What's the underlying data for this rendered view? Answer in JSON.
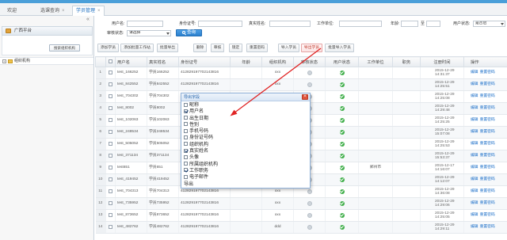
{
  "tabs": [
    {
      "label": "欢迎"
    },
    {
      "label": "选课查询"
    },
    {
      "label": "学员管理"
    }
  ],
  "sidebar": {
    "panel_title": "广西平台",
    "search_button": "搜索组织机构",
    "tree_root": "组织机构"
  },
  "search": {
    "username_label": "用户名:",
    "idcard_label": "身份证号:",
    "realname_label": "真实姓名:",
    "company_label": "工作单位:",
    "age_label": "年龄:",
    "age_to": "至",
    "user_status_label": "用户状态:",
    "user_status_value": "是否启",
    "audit_label": "审核状态:",
    "audit_value": "请选择",
    "query_button": "查询"
  },
  "toolbar": {
    "buttons": [
      "添加学员",
      "添加批量工作站",
      "批量导出",
      "删除",
      "审核",
      "锁定",
      "重置密码",
      "导入学员",
      "导出学员",
      "批量导入学员"
    ]
  },
  "table": {
    "headers": [
      "用户名",
      "真实姓名",
      "身份证号",
      "年龄",
      "组织机构",
      "审核状态",
      "用户状态",
      "工作单位",
      "职务",
      "注册时间",
      "操作"
    ],
    "rows": [
      {
        "num": "1",
        "username": "test_166252",
        "realname": "学员166252",
        "idcard": "412829197702143816",
        "age": "",
        "org": "xxx",
        "audit_icon": "grey-circle-icon",
        "status_icon": "green-check-icon",
        "company": "",
        "position": "",
        "reg_date": "2015-12-29",
        "reg_time": "14:31:37",
        "actions": [
          "编辑",
          "重置密码"
        ]
      },
      {
        "num": "2",
        "username": "test_842552",
        "realname": "学员842552",
        "idcard": "412829197702143816",
        "age": "",
        "org": "xxx",
        "audit_icon": "grey-circle-icon",
        "status_icon": "green-check-icon",
        "company": "",
        "position": "",
        "reg_date": "2015-12-29",
        "reg_time": "14:25:51",
        "actions": [
          "编辑",
          "重置密码"
        ]
      },
      {
        "num": "3",
        "username": "test_704302",
        "realname": "学员704302",
        "idcard": "412829197702143816",
        "age": "",
        "org": "xxx",
        "audit_icon": "grey-circle-icon",
        "status_icon": "green-check-icon",
        "company": "",
        "position": "",
        "reg_date": "2015-12-29",
        "reg_time": "14:25:08",
        "actions": [
          "编辑",
          "重置密码"
        ]
      },
      {
        "num": "4",
        "username": "test_8002",
        "realname": "学员8002",
        "idcard": "412829197702143816",
        "age": "",
        "org": "",
        "audit_icon": "grey-circle-icon",
        "status_icon": "green-check-icon",
        "company": "",
        "position": "",
        "reg_date": "2015-12-29",
        "reg_time": "14:29:48",
        "actions": [
          "编辑",
          "重置密码"
        ]
      },
      {
        "num": "5",
        "username": "test_102063",
        "realname": "学员102063",
        "idcard": "412829197702143816",
        "age": "",
        "org": "",
        "audit_icon": "grey-circle-icon",
        "status_icon": "green-check-icon",
        "company": "",
        "position": "",
        "reg_date": "2015-12-29",
        "reg_time": "14:25:25",
        "actions": [
          "编辑",
          "重置密码"
        ]
      },
      {
        "num": "6",
        "username": "test_248534",
        "realname": "学员248534",
        "idcard": "412829197702143816",
        "age": "",
        "org": "",
        "audit_icon": "grey-circle-icon",
        "status_icon": "green-check-icon",
        "company": "",
        "position": "",
        "reg_date": "2015-12-29",
        "reg_time": "15:07:08",
        "actions": [
          "编辑",
          "重置密码"
        ]
      },
      {
        "num": "7",
        "username": "test_505052",
        "realname": "学员505052",
        "idcard": "412829197702143816",
        "age": "",
        "org": "xxx",
        "audit_icon": "grey-circle-icon",
        "status_icon": "green-check-icon",
        "company": "",
        "position": "",
        "reg_date": "2015-12-29",
        "reg_time": "14:25:53",
        "actions": [
          "编辑",
          "重置密码"
        ]
      },
      {
        "num": "8",
        "username": "test_371134",
        "realname": "学员371134",
        "idcard": "412829197702143816",
        "age": "",
        "org": "",
        "audit_icon": "grey-circle-icon",
        "status_icon": "green-check-icon",
        "company": "",
        "position": "",
        "reg_date": "2015-12-29",
        "reg_time": "15:53:37",
        "actions": [
          "编辑",
          "重置密码"
        ]
      },
      {
        "num": "9",
        "username": "test651",
        "realname": "学员651",
        "idcard": "412829197702143816",
        "age": "",
        "org": "",
        "audit_icon": "grey-circle-icon",
        "status_icon": "green-check-icon",
        "company": "郑州市",
        "position": "",
        "reg_date": "2015-12-17",
        "reg_time": "14:16:07",
        "actions": [
          "编辑",
          "重置密码"
        ]
      },
      {
        "num": "10",
        "username": "test_419452",
        "realname": "学员419452",
        "idcard": "412829197702143816",
        "age": "",
        "org": "",
        "audit_icon": "grey-circle-icon",
        "status_icon": "green-check-icon",
        "company": "",
        "position": "",
        "reg_date": "2015-12-29",
        "reg_time": "14:12:07",
        "actions": [
          "编辑",
          "重置密码"
        ]
      },
      {
        "num": "11",
        "username": "test_704313",
        "realname": "学员704313",
        "idcard": "412829197702143816",
        "age": "",
        "org": "xxx",
        "audit_icon": "grey-circle-icon",
        "status_icon": "green-check-icon",
        "company": "",
        "position": "",
        "reg_date": "2015-12-29",
        "reg_time": "14:36:08",
        "actions": [
          "编辑",
          "重置密码"
        ]
      },
      {
        "num": "12",
        "username": "test_735952",
        "realname": "学员735952",
        "idcard": "412829197702143816",
        "age": "",
        "org": "xxx",
        "audit_icon": "grey-circle-icon",
        "status_icon": "green-check-icon",
        "company": "",
        "position": "",
        "reg_date": "2015-12-29",
        "reg_time": "14:29:06",
        "actions": [
          "编辑",
          "重置密码"
        ]
      },
      {
        "num": "13",
        "username": "test_873652",
        "realname": "学员873652",
        "idcard": "412829197702143816",
        "age": "",
        "org": "xxx",
        "audit_icon": "grey-circle-icon",
        "status_icon": "green-check-icon",
        "company": "",
        "position": "",
        "reg_date": "2015-12-29",
        "reg_time": "14:25:05",
        "actions": [
          "编辑",
          "重置密码"
        ]
      },
      {
        "num": "14",
        "username": "test_482762",
        "realname": "学员482762",
        "idcard": "412829197702143816",
        "age": "",
        "org": "ddd",
        "audit_icon": "grey-circle-icon",
        "status_icon": "green-check-icon",
        "company": "",
        "position": "",
        "reg_date": "2015-12-29",
        "reg_time": "14:29:11",
        "actions": [
          "编辑",
          "重置密码"
        ]
      }
    ]
  },
  "dialog": {
    "title": "导出字段",
    "fields": [
      {
        "label": "昵称",
        "checked": false
      },
      {
        "label": "用户名",
        "checked": true
      },
      {
        "label": "出生日期",
        "checked": false
      },
      {
        "label": "性别",
        "checked": false
      },
      {
        "label": "手机号码",
        "checked": false
      },
      {
        "label": "身份证号码",
        "checked": false
      },
      {
        "label": "组织机构",
        "checked": false
      },
      {
        "label": "真实姓名",
        "checked": true
      },
      {
        "label": "头像",
        "checked": false
      },
      {
        "label": "所属组织机构",
        "checked": false
      },
      {
        "label": "工作职务",
        "checked": true
      },
      {
        "label": "电子邮件",
        "checked": false
      }
    ],
    "confirm": "导出"
  },
  "colors": {
    "topbar": "#4a9fd9",
    "accent": "#2a7fcc",
    "status_ok": "#3fae49",
    "annotation_arrow": "#e02424"
  }
}
